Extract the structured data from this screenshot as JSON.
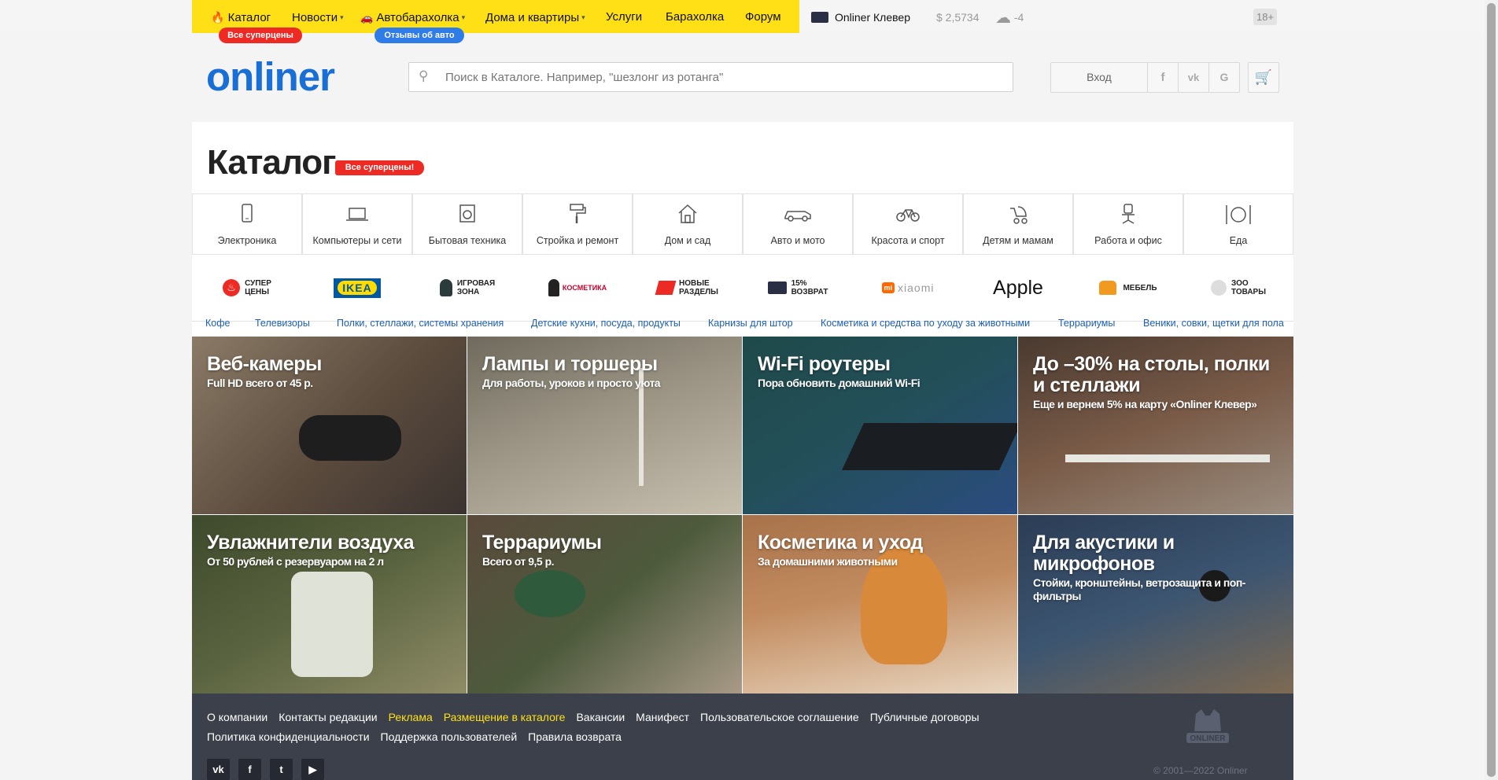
{
  "topnav": {
    "items": [
      {
        "label": "Каталог"
      },
      {
        "label": "Новости"
      },
      {
        "label": "Автобарахолка"
      },
      {
        "label": "Дома и квартиры"
      },
      {
        "label": "Услуги"
      },
      {
        "label": "Барахолка"
      },
      {
        "label": "Форум"
      }
    ],
    "badge_catalog": "Все суперцены",
    "badge_auto": "Отзывы об авто",
    "clever": "Onliner Клевер",
    "rate": "$ 2,5734",
    "weather": "-4",
    "age": "18+"
  },
  "header": {
    "logo": "onliner",
    "search_placeholder": "Поиск в Каталоге. Например, \"шезлонг из ротанга\"",
    "login": "Вход",
    "social": [
      "f",
      "vk",
      "G"
    ]
  },
  "catalog": {
    "title": "Каталог",
    "badge": "Все суперцены!",
    "categories": [
      "Электроника",
      "Компьютеры и сети",
      "Бытовая техника",
      "Стройка и ремонт",
      "Дом и сад",
      "Авто и мото",
      "Красота и спорт",
      "Детям и мамам",
      "Работа и офис",
      "Еда"
    ],
    "promos": [
      {
        "line1": "СУПЕР",
        "line2": "ЦЕНЫ"
      },
      {
        "line1": "IKEA",
        "line2": ""
      },
      {
        "line1": "ИГРОВАЯ",
        "line2": "ЗОНА"
      },
      {
        "line1": "КОСМЕТИКА",
        "line2": ""
      },
      {
        "line1": "НОВЫЕ",
        "line2": "РАЗДЕЛЫ"
      },
      {
        "line1": "15%",
        "line2": "ВОЗВРАТ"
      },
      {
        "line1": "xiaomi",
        "line2": ""
      },
      {
        "line1": "Apple",
        "line2": ""
      },
      {
        "line1": "МЕБЕЛЬ",
        "line2": ""
      },
      {
        "line1": "ЗОО",
        "line2": "ТОВАРЫ"
      }
    ],
    "quick_links": [
      "Кофе",
      "Телевизоры",
      "Полки, стеллажи, системы хранения",
      "Детские кухни, посуда, продукты",
      "Карнизы для штор",
      "Косметика и средства по уходу за животными",
      "Террариумы",
      "Веники, совки, щетки для пола"
    ],
    "tiles": [
      {
        "title": "Веб-камеры",
        "subtitle": "Full HD всего от 45 р."
      },
      {
        "title": "Лампы и торшеры",
        "subtitle": "Для работы, уроков и просто уюта"
      },
      {
        "title": "Wi-Fi роутеры",
        "subtitle": "Пора обновить домашний Wi-Fi"
      },
      {
        "title": "До –30% на столы, полки и стеллажи",
        "subtitle": "Еще и вернем 5% на карту «Onliner Клевер»"
      },
      {
        "title": "Увлажнители воздуха",
        "subtitle": "От 50 рублей с резервуаром на 2 л"
      },
      {
        "title": "Террариумы",
        "subtitle": "Всего от 9,5 р."
      },
      {
        "title": "Косметика и уход",
        "subtitle": "За домашними животными"
      },
      {
        "title": "Для акустики и микрофонов",
        "subtitle": "Стойки, кронштейны, ветрозащита и поп-фильтры"
      }
    ]
  },
  "footer": {
    "links_row1": [
      "О компании",
      "Контакты редакции",
      "Реклама",
      "Размещение в каталоге",
      "Вакансии",
      "Манифест",
      "Пользовательское соглашение",
      "Публичные договоры"
    ],
    "links_row2": [
      "Политика конфиденциальности",
      "Поддержка пользователей",
      "Правила возврата"
    ],
    "copyright": "© 2001—2022 Onliner",
    "mascot_label": "ONLINER"
  }
}
